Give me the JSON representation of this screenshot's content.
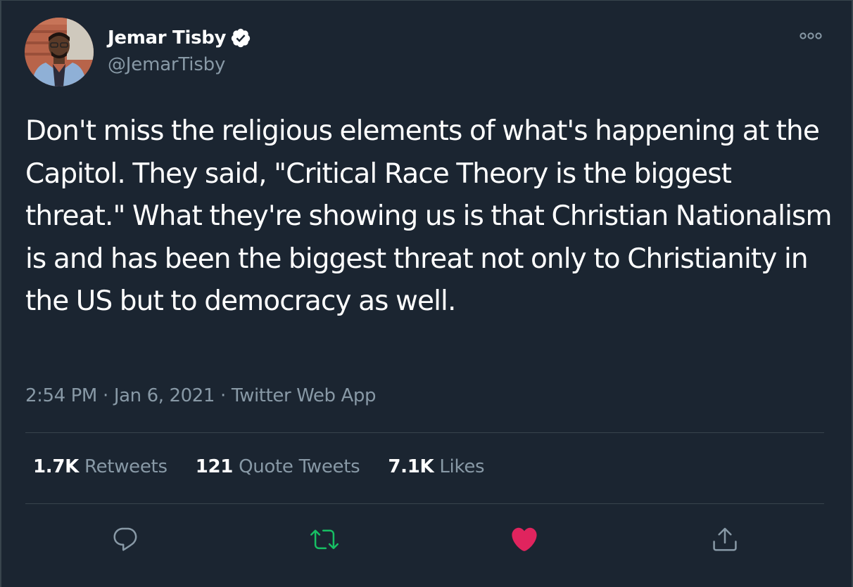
{
  "author": {
    "name": "Jemar Tisby",
    "handle": "@JemarTisby",
    "verified": true,
    "avatar_icon": "profile-photo"
  },
  "tweet": {
    "text": "Don't miss the religious elements of what's happening at the Capitol. They said, \"Critical Race Theory is the biggest threat.\" What they're showing us is that Christian Nationalism is and has been the biggest threat not only to Christianity in the US but to democracy as well.",
    "time": "2:54 PM",
    "date": "Jan 6, 2021",
    "source": "Twitter Web App",
    "separator": "·"
  },
  "stats": {
    "retweets_count": "1.7K",
    "retweets_label": "Retweets",
    "quotes_count": "121",
    "quotes_label": "Quote Tweets",
    "likes_count": "7.1K",
    "likes_label": "Likes"
  },
  "actions": [
    {
      "icon": "reply-icon"
    },
    {
      "icon": "retweet-icon",
      "color": "#17bf63",
      "active": true
    },
    {
      "icon": "like-icon",
      "color": "#e0245e",
      "active": true
    },
    {
      "icon": "share-icon"
    }
  ],
  "colors": {
    "background": "#1b2531",
    "text_primary": "#ffffff",
    "text_secondary": "#8899a6",
    "border": "#38444d",
    "verified_badge": "#ffffff",
    "retweet_active": "#17bf63",
    "like_active": "#e0245e"
  }
}
